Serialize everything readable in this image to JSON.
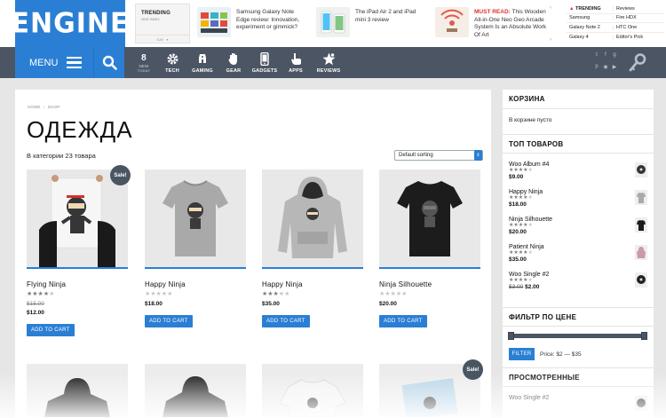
{
  "header": {
    "logo": "ENGINE",
    "trending_box": {
      "title": "TRENDING",
      "subtitle": "HEAT INDEX",
      "dropdown": "DAY"
    },
    "news": [
      {
        "text": "Samsung Galaxy Note Edge review: Innovation, experiment or gimmick?",
        "badge": ""
      },
      {
        "text": "The iPad Air 2 and iPad mini 3 review",
        "badge": ""
      },
      {
        "text": "This Wooden All-in-One Neo Geo Arcade System Is an Absolute Work Of Art",
        "badge": "MUST READ:"
      }
    ],
    "table": {
      "head": [
        "TRENDING",
        "Reviews"
      ],
      "rows": [
        [
          "Samsung",
          "Fire HDX"
        ],
        [
          "Galaxy Note 2",
          "HTC One"
        ],
        [
          "Galaxy 4",
          "Editor's Pick"
        ]
      ]
    }
  },
  "nav": {
    "menu_label": "MENU",
    "new_today": {
      "count": "8",
      "line1": "NEW",
      "line2": "TODAY"
    },
    "items": [
      {
        "label": "TECH",
        "icon": "gear-icon"
      },
      {
        "label": "GAMING",
        "icon": "gamepad-icon"
      },
      {
        "label": "GEAR",
        "icon": "glove-icon"
      },
      {
        "label": "GADGETS",
        "icon": "phone-icon"
      },
      {
        "label": "APPS",
        "icon": "hand-icon"
      },
      {
        "label": "REVIEWS",
        "icon": "star-icon"
      }
    ]
  },
  "breadcrumb": {
    "home": "HOME",
    "current": "SHOP"
  },
  "page_title": "ОДЕЖДА",
  "result_count": "В категории 23 товара",
  "sort_label": "Default sorting",
  "products": [
    {
      "name": "Flying Ninja",
      "rating": 4,
      "old_price": "$15.00",
      "price": "$12.00",
      "sale": "Sale!",
      "button": "ADD TO CART"
    },
    {
      "name": "Happy Ninja",
      "rating": 0,
      "old_price": "",
      "price": "$18.00",
      "sale": "",
      "button": "ADD TO CART"
    },
    {
      "name": "Happy Ninja",
      "rating": 3,
      "old_price": "",
      "price": "$35.00",
      "sale": "",
      "button": "ADD TO CART"
    },
    {
      "name": "Ninja Silhouette",
      "rating": 0,
      "old_price": "",
      "price": "$20.00",
      "sale": "",
      "button": "ADD TO CART"
    }
  ],
  "products_row2_sale": "Sale!",
  "sidebar": {
    "cart_title": "КОРЗИНА",
    "cart_empty": "В корзине пусто",
    "top_title": "ТОП ТОВАРОВ",
    "top_products": [
      {
        "name": "Woo Album #4",
        "rating": 4,
        "old_price": "",
        "price": "$9.00"
      },
      {
        "name": "Happy Ninja",
        "rating": 4,
        "old_price": "",
        "price": "$18.00"
      },
      {
        "name": "Ninja Silhouette",
        "rating": 4,
        "old_price": "",
        "price": "$20.00"
      },
      {
        "name": "Patient Ninja",
        "rating": 4,
        "old_price": "",
        "price": "$35.00"
      },
      {
        "name": "Woo Single #2",
        "rating": 4,
        "old_price": "$3.00",
        "price": "$2.00"
      }
    ],
    "filter_title": "ФИЛЬТР ПО ЦЕНЕ",
    "filter_button": "FILTER",
    "price_range": "Price: $2 — $35",
    "viewed_title": "ПРОСМОТРЕННЫЕ",
    "viewed_first": "Woo Single #2"
  },
  "colors": {
    "accent": "#2a7fd4",
    "nav": "#4b5563",
    "sale_badge": "#4a5563"
  }
}
